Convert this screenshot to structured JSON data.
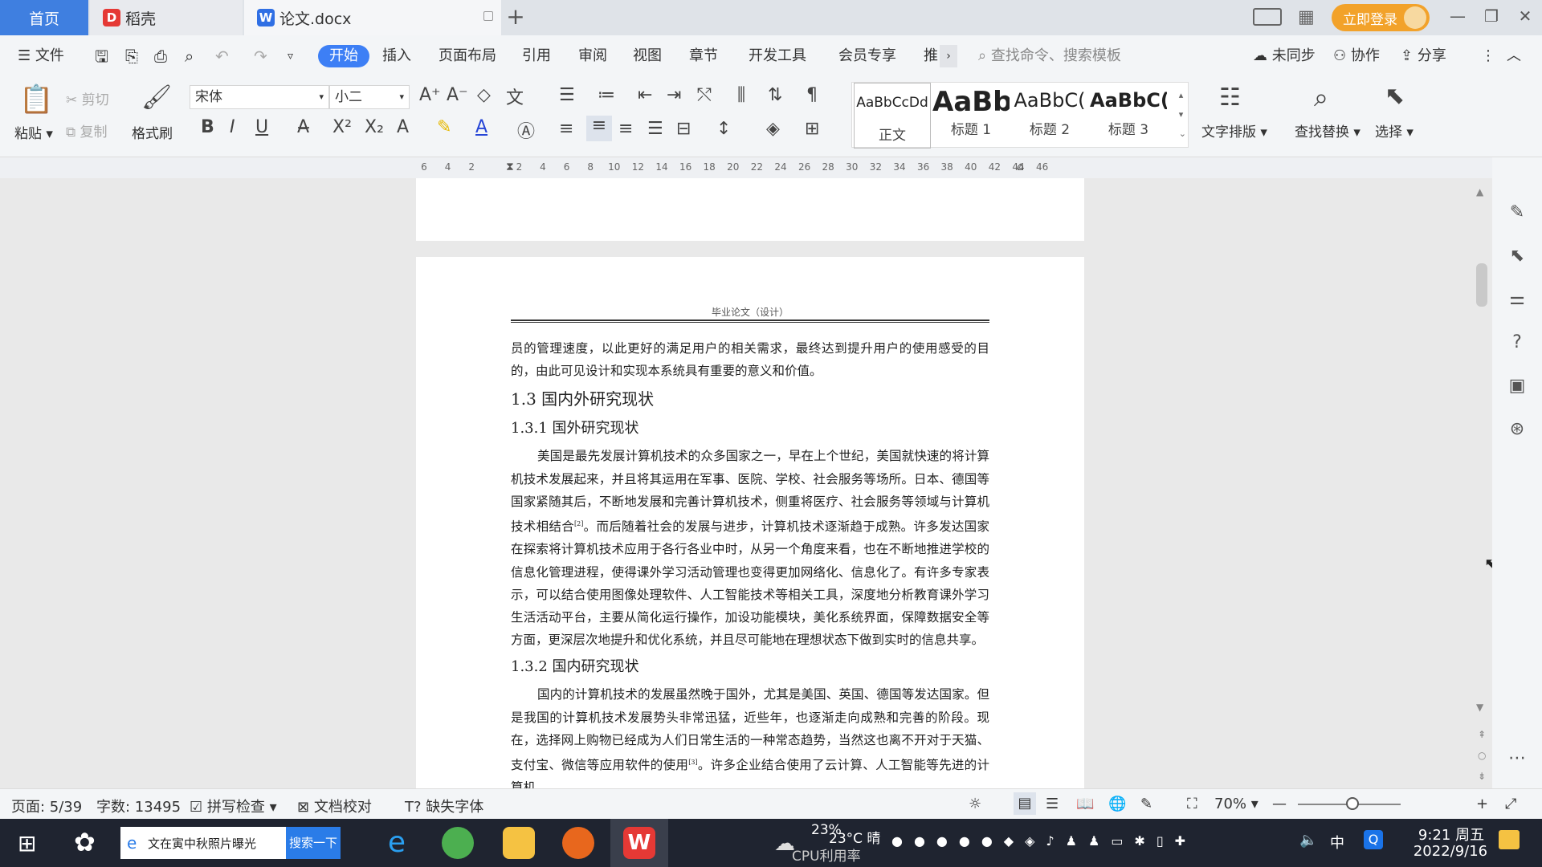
{
  "tabs": {
    "home": "首页",
    "daoke": "稻壳",
    "doc": "论文.docx"
  },
  "titlebar": {
    "login": "立即登录"
  },
  "menu": {
    "file": "文件",
    "items": [
      "开始",
      "插入",
      "页面布局",
      "引用",
      "审阅",
      "视图",
      "章节",
      "开发工具",
      "会员专享",
      "推"
    ],
    "search_placeholder": "查找命令、搜索模板",
    "unsynced": "未同步",
    "collab": "协作",
    "share": "分享"
  },
  "ribbon": {
    "paste": "粘贴",
    "cut": "剪切",
    "copy": "复制",
    "format_painter": "格式刷",
    "font": "宋体",
    "size": "小二",
    "styles": [
      {
        "preview": "AaBbCcDd",
        "label": "正文"
      },
      {
        "preview": "AaBb",
        "label": "标题 1"
      },
      {
        "preview": "AaBbC(",
        "label": "标题 2"
      },
      {
        "preview": "AaBbC(",
        "label": "标题 3"
      }
    ],
    "text_layout": "文字排版",
    "find_replace": "查找替换",
    "select": "选择"
  },
  "ruler": {
    "ticks": [
      "6",
      "4",
      "2",
      "",
      "2",
      "4",
      "6",
      "8",
      "10",
      "12",
      "14",
      "16",
      "18",
      "20",
      "22",
      "24",
      "26",
      "28",
      "30",
      "32",
      "34",
      "36",
      "38",
      "40",
      "42",
      "44",
      "46"
    ]
  },
  "document": {
    "running_header": "毕业论文（设计）",
    "p_cont": "员的管理速度，以此更好的满足用户的相关需求，最终达到提升用户的使用感受的目的，由此可见设计和实现本系统具有重要的意义和价值。",
    "h_13": "1.3 国内外研究现状",
    "h_131": "1.3.1 国外研究现状",
    "p_foreign_a": "美国是最先发展计算机技术的众多国家之一，早在上个世纪，美国就快速的将计算机技术发展起来，并且将其运用在军事、医院、学校、社会服务等场所。日本、德国等国家紧随其后，不断地发展和完善计算机技术，侧重将医疗、社会服务等领域与计算机技术相结合",
    "ref2": "[2]",
    "p_foreign_b": "。而后随着社会的发展与进步，计算机技术逐渐趋于成熟。许多发达国家在探索将计算机技术应用于各行各业中时，从另一个角度来看，也在不断地推进学校的信息化管理进程，使得课外学习活动管理也变得更加网络化、信息化了。有许多专家表示，可以结合使用图像处理软件、人工智能技术等相关工具，深度地分析教育课外学习生活活动平台，主要从简化运行操作，加设功能模块，美化系统界面，保障数据安全等方面，更深层次地提升和优化系统，并且尽可能地在理想状态下做到实时的信息共享。",
    "h_132": "1.3.2 国内研究现状",
    "p_domestic_a": "国内的计算机技术的发展虽然晚于国外，尤其是美国、英国、德国等发达国家。但是我国的计算机技术发展势头非常迅猛，近些年，也逐渐走向成熟和完善的阶段。现在，选择网上购物已经成为人们日常生活的一种常态趋势，当然这也离不开对于天猫、支付宝、微信等应用软件的使用",
    "ref3": "[3]",
    "p_domestic_b": "。许多企业结合使用了云计算、人工智能等先进的计算机"
  },
  "status": {
    "page": "页面: 5/39",
    "words": "字数: 13495",
    "spell": "拼写检查",
    "proof": "文档校对",
    "missing_font": "缺失字体",
    "zoom": "70%"
  },
  "taskbar": {
    "search_text": "文在寅中秋照片曝光",
    "search_btn": "搜索一下",
    "weather": "23°C 晴",
    "cpu": "23%",
    "cpu_label": "CPU利用率",
    "ime": "中",
    "time": "9:21 周五",
    "date": "2022/9/16"
  },
  "colors": {
    "accent": "#3d7ff5",
    "login": "#f2a22a",
    "taskbar": "#1f2430"
  }
}
